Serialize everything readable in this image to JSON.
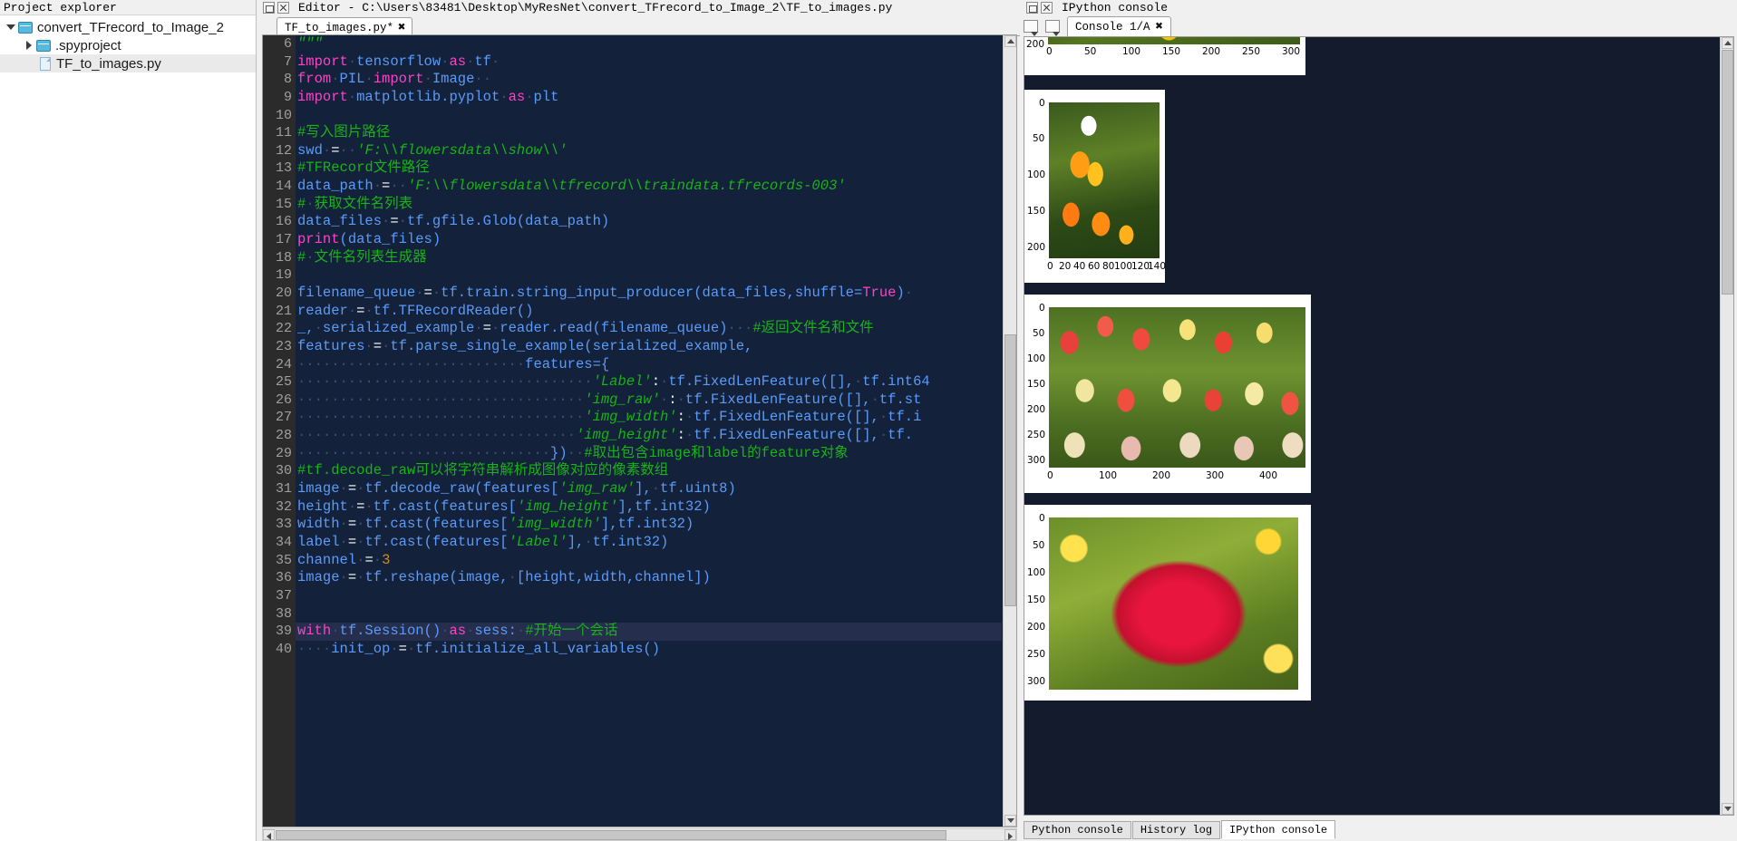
{
  "project_explorer": {
    "title": "Project explorer",
    "tree": [
      {
        "label": "convert_TFrecord_to_Image_2",
        "type": "folder",
        "indent": 1,
        "expanded": true,
        "selected": false
      },
      {
        "label": ".spyproject",
        "type": "folder",
        "indent": 2,
        "expanded": false,
        "selected": false
      },
      {
        "label": "TF_to_images.py",
        "type": "file",
        "indent": 3,
        "expanded": null,
        "selected": true
      }
    ]
  },
  "editor": {
    "title": "Editor - C:\\Users\\83481\\Desktop\\MyResNet\\convert_TFrecord_to_Image_2\\TF_to_images.py",
    "tab": {
      "label": "TF_to_images.py*",
      "close": "✖"
    },
    "first_line_number": 6,
    "highlighted_line": 39,
    "lines": [
      {
        "n": 6,
        "tokens": [
          {
            "t": "\"\"\"",
            "c": "str"
          }
        ]
      },
      {
        "n": 7,
        "tokens": [
          {
            "t": "import",
            "c": "kw"
          },
          {
            "t": "·",
            "c": "dot"
          },
          {
            "t": "tensorflow",
            "c": "id"
          },
          {
            "t": "·",
            "c": "dot"
          },
          {
            "t": "as",
            "c": "kw"
          },
          {
            "t": "·",
            "c": "dot"
          },
          {
            "t": "tf",
            "c": "id"
          },
          {
            "t": "·",
            "c": "dot"
          }
        ]
      },
      {
        "n": 8,
        "tokens": [
          {
            "t": "from",
            "c": "kw"
          },
          {
            "t": "·",
            "c": "dot"
          },
          {
            "t": "PIL",
            "c": "id"
          },
          {
            "t": "·",
            "c": "dot"
          },
          {
            "t": "import",
            "c": "kw"
          },
          {
            "t": "·",
            "c": "dot"
          },
          {
            "t": "Image",
            "c": "id"
          },
          {
            "t": "··",
            "c": "dot"
          }
        ]
      },
      {
        "n": 9,
        "tokens": [
          {
            "t": "import",
            "c": "kw"
          },
          {
            "t": "·",
            "c": "dot"
          },
          {
            "t": "matplotlib.pyplot",
            "c": "id"
          },
          {
            "t": "·",
            "c": "dot"
          },
          {
            "t": "as",
            "c": "kw"
          },
          {
            "t": "·",
            "c": "dot"
          },
          {
            "t": "plt",
            "c": "id"
          }
        ]
      },
      {
        "n": 10,
        "tokens": []
      },
      {
        "n": 11,
        "tokens": [
          {
            "t": "#写入图片路径",
            "c": "com"
          }
        ]
      },
      {
        "n": 12,
        "tokens": [
          {
            "t": "swd",
            "c": "id"
          },
          {
            "t": "·",
            "c": "dot"
          },
          {
            "t": "=",
            "c": "pl"
          },
          {
            "t": "··",
            "c": "dot"
          },
          {
            "t": "'F:\\\\flowersdata\\\\show\\\\'",
            "c": "str"
          }
        ]
      },
      {
        "n": 13,
        "tokens": [
          {
            "t": "#TFRecord文件路径",
            "c": "com"
          }
        ]
      },
      {
        "n": 14,
        "tokens": [
          {
            "t": "data_path",
            "c": "id"
          },
          {
            "t": "·",
            "c": "dot"
          },
          {
            "t": "=",
            "c": "pl"
          },
          {
            "t": "··",
            "c": "dot"
          },
          {
            "t": "'F:\\\\flowersdata\\\\tfrecord\\\\traindata.tfrecords-003'",
            "c": "str"
          }
        ]
      },
      {
        "n": 15,
        "tokens": [
          {
            "t": "#",
            "c": "com"
          },
          {
            "t": "·",
            "c": "dot"
          },
          {
            "t": "获取文件名列表",
            "c": "com"
          }
        ]
      },
      {
        "n": 16,
        "tokens": [
          {
            "t": "data_files",
            "c": "id"
          },
          {
            "t": "·",
            "c": "dot"
          },
          {
            "t": "=",
            "c": "pl"
          },
          {
            "t": "·",
            "c": "dot"
          },
          {
            "t": "tf.gfile.Glob(data_path)",
            "c": "id"
          }
        ]
      },
      {
        "n": 17,
        "tokens": [
          {
            "t": "print",
            "c": "kw"
          },
          {
            "t": "(data_files)",
            "c": "id"
          }
        ]
      },
      {
        "n": 18,
        "tokens": [
          {
            "t": "#",
            "c": "com"
          },
          {
            "t": "·",
            "c": "dot"
          },
          {
            "t": "文件名列表生成器",
            "c": "com"
          }
        ]
      },
      {
        "n": 19,
        "tokens": []
      },
      {
        "n": 20,
        "tokens": [
          {
            "t": "filename_queue",
            "c": "id"
          },
          {
            "t": "·",
            "c": "dot"
          },
          {
            "t": "=",
            "c": "pl"
          },
          {
            "t": "·",
            "c": "dot"
          },
          {
            "t": "tf.train.string_input_producer(data_files,shuffle=",
            "c": "id"
          },
          {
            "t": "True",
            "c": "kw"
          },
          {
            "t": ")",
            "c": "id"
          },
          {
            "t": "·",
            "c": "dot"
          }
        ]
      },
      {
        "n": 21,
        "tokens": [
          {
            "t": "reader",
            "c": "id"
          },
          {
            "t": "·",
            "c": "dot"
          },
          {
            "t": "=",
            "c": "pl"
          },
          {
            "t": "·",
            "c": "dot"
          },
          {
            "t": "tf.TFRecordReader()",
            "c": "id"
          }
        ]
      },
      {
        "n": 22,
        "tokens": [
          {
            "t": "_,",
            "c": "id"
          },
          {
            "t": "·",
            "c": "dot"
          },
          {
            "t": "serialized_example",
            "c": "id"
          },
          {
            "t": "·",
            "c": "dot"
          },
          {
            "t": "=",
            "c": "pl"
          },
          {
            "t": "·",
            "c": "dot"
          },
          {
            "t": "reader.read(filename_queue)",
            "c": "id"
          },
          {
            "t": "···",
            "c": "dot"
          },
          {
            "t": "#返回文件名和文件",
            "c": "com"
          }
        ]
      },
      {
        "n": 23,
        "tokens": [
          {
            "t": "features",
            "c": "id"
          },
          {
            "t": "·",
            "c": "dot"
          },
          {
            "t": "=",
            "c": "pl"
          },
          {
            "t": "·",
            "c": "dot"
          },
          {
            "t": "tf.parse_single_example(serialized_example,",
            "c": "id"
          }
        ]
      },
      {
        "n": 24,
        "tokens": [
          {
            "t": "···························",
            "c": "dot"
          },
          {
            "t": "features={",
            "c": "id"
          }
        ]
      },
      {
        "n": 25,
        "tokens": [
          {
            "t": "···································",
            "c": "dot"
          },
          {
            "t": "'Label'",
            "c": "str"
          },
          {
            "t": ":",
            "c": "pl"
          },
          {
            "t": "·",
            "c": "dot"
          },
          {
            "t": "tf.FixedLenFeature([],",
            "c": "id"
          },
          {
            "t": "·",
            "c": "dot"
          },
          {
            "t": "tf.int64",
            "c": "id"
          }
        ]
      },
      {
        "n": 26,
        "tokens": [
          {
            "t": "··································",
            "c": "dot"
          },
          {
            "t": "'img_raw'",
            "c": "str"
          },
          {
            "t": "·",
            "c": "dot"
          },
          {
            "t": ":",
            "c": "pl"
          },
          {
            "t": "·",
            "c": "dot"
          },
          {
            "t": "tf.FixedLenFeature([],",
            "c": "id"
          },
          {
            "t": "·",
            "c": "dot"
          },
          {
            "t": "tf.st",
            "c": "id"
          }
        ]
      },
      {
        "n": 27,
        "tokens": [
          {
            "t": "··································",
            "c": "dot"
          },
          {
            "t": "'img_width'",
            "c": "str"
          },
          {
            "t": ":",
            "c": "pl"
          },
          {
            "t": "·",
            "c": "dot"
          },
          {
            "t": "tf.FixedLenFeature([],",
            "c": "id"
          },
          {
            "t": "·",
            "c": "dot"
          },
          {
            "t": "tf.i",
            "c": "id"
          }
        ]
      },
      {
        "n": 28,
        "tokens": [
          {
            "t": "·································",
            "c": "dot"
          },
          {
            "t": "'img_height'",
            "c": "str"
          },
          {
            "t": ":",
            "c": "pl"
          },
          {
            "t": "·",
            "c": "dot"
          },
          {
            "t": "tf.FixedLenFeature([],",
            "c": "id"
          },
          {
            "t": "·",
            "c": "dot"
          },
          {
            "t": "tf.",
            "c": "id"
          }
        ]
      },
      {
        "n": 29,
        "tokens": [
          {
            "t": "······························",
            "c": "dot"
          },
          {
            "t": "})",
            "c": "id"
          },
          {
            "t": "··",
            "c": "dot"
          },
          {
            "t": "#取出包含image和label的feature对象",
            "c": "com"
          }
        ]
      },
      {
        "n": 30,
        "tokens": [
          {
            "t": "#tf.decode_raw可以将字符串解析成图像对应的像素数组",
            "c": "com"
          }
        ]
      },
      {
        "n": 31,
        "tokens": [
          {
            "t": "image",
            "c": "id"
          },
          {
            "t": "·",
            "c": "dot"
          },
          {
            "t": "=",
            "c": "pl"
          },
          {
            "t": "·",
            "c": "dot"
          },
          {
            "t": "tf.decode_raw(features[",
            "c": "id"
          },
          {
            "t": "'img_raw'",
            "c": "str"
          },
          {
            "t": "],",
            "c": "id"
          },
          {
            "t": "·",
            "c": "dot"
          },
          {
            "t": "tf.uint8)",
            "c": "id"
          }
        ]
      },
      {
        "n": 32,
        "tokens": [
          {
            "t": "height",
            "c": "id"
          },
          {
            "t": "·",
            "c": "dot"
          },
          {
            "t": "=",
            "c": "pl"
          },
          {
            "t": "·",
            "c": "dot"
          },
          {
            "t": "tf.cast(features[",
            "c": "id"
          },
          {
            "t": "'img_height'",
            "c": "str"
          },
          {
            "t": "],tf.int32)",
            "c": "id"
          }
        ]
      },
      {
        "n": 33,
        "tokens": [
          {
            "t": "width",
            "c": "id"
          },
          {
            "t": "·",
            "c": "dot"
          },
          {
            "t": "=",
            "c": "pl"
          },
          {
            "t": "·",
            "c": "dot"
          },
          {
            "t": "tf.cast(features[",
            "c": "id"
          },
          {
            "t": "'img_width'",
            "c": "str"
          },
          {
            "t": "],tf.int32)",
            "c": "id"
          }
        ]
      },
      {
        "n": 34,
        "tokens": [
          {
            "t": "label",
            "c": "id"
          },
          {
            "t": "·",
            "c": "dot"
          },
          {
            "t": "=",
            "c": "pl"
          },
          {
            "t": "·",
            "c": "dot"
          },
          {
            "t": "tf.cast(features[",
            "c": "id"
          },
          {
            "t": "'Label'",
            "c": "str"
          },
          {
            "t": "],",
            "c": "id"
          },
          {
            "t": "·",
            "c": "dot"
          },
          {
            "t": "tf.int32)",
            "c": "id"
          }
        ]
      },
      {
        "n": 35,
        "tokens": [
          {
            "t": "channel",
            "c": "id"
          },
          {
            "t": "·",
            "c": "dot"
          },
          {
            "t": "=",
            "c": "pl"
          },
          {
            "t": "·",
            "c": "dot"
          },
          {
            "t": "3",
            "c": "num"
          }
        ]
      },
      {
        "n": 36,
        "tokens": [
          {
            "t": "image",
            "c": "id"
          },
          {
            "t": "·",
            "c": "dot"
          },
          {
            "t": "=",
            "c": "pl"
          },
          {
            "t": "·",
            "c": "dot"
          },
          {
            "t": "tf.reshape(image,",
            "c": "id"
          },
          {
            "t": "·",
            "c": "dot"
          },
          {
            "t": "[height,width,channel])",
            "c": "id"
          }
        ]
      },
      {
        "n": 37,
        "tokens": []
      },
      {
        "n": 38,
        "tokens": []
      },
      {
        "n": 39,
        "tokens": [
          {
            "t": "with",
            "c": "kw"
          },
          {
            "t": "·",
            "c": "dot"
          },
          {
            "t": "tf.Session()",
            "c": "id"
          },
          {
            "t": "·",
            "c": "dot"
          },
          {
            "t": "as",
            "c": "kw"
          },
          {
            "t": "·",
            "c": "dot"
          },
          {
            "t": "sess:",
            "c": "id"
          },
          {
            "t": "·",
            "c": "dot"
          },
          {
            "t": "#开始一个会话",
            "c": "com"
          }
        ]
      },
      {
        "n": 40,
        "tokens": [
          {
            "t": "····",
            "c": "dot"
          },
          {
            "t": "init_op",
            "c": "id"
          },
          {
            "t": "·",
            "c": "dot"
          },
          {
            "t": "=",
            "c": "pl"
          },
          {
            "t": "·",
            "c": "dot"
          },
          {
            "t": "tf.initialize_all_variables()",
            "c": "id"
          }
        ]
      }
    ]
  },
  "console": {
    "title": "IPython console",
    "tab": {
      "label": "Console 1/A",
      "close": "✖"
    },
    "bottom_tabs": [
      {
        "label": "Python console",
        "active": false
      },
      {
        "label": "History log",
        "active": false
      },
      {
        "label": "IPython console",
        "active": true
      }
    ],
    "plots": [
      {
        "name": "plot-1-partial",
        "yticks": [
          "200"
        ],
        "xticks": [
          "0",
          "50",
          "100",
          "150",
          "200",
          "250",
          "300"
        ],
        "kind": "image"
      },
      {
        "name": "plot-2-tulips-yellow",
        "yticks": [
          "0",
          "50",
          "100",
          "150",
          "200"
        ],
        "xticks": [
          "0",
          "20",
          "40",
          "60",
          "80",
          "100",
          "120",
          "140"
        ],
        "kind": "image"
      },
      {
        "name": "plot-3-tulip-field",
        "yticks": [
          "0",
          "50",
          "100",
          "150",
          "200",
          "250",
          "300"
        ],
        "xticks": [
          "0",
          "100",
          "200",
          "300",
          "400"
        ],
        "kind": "image"
      },
      {
        "name": "plot-4-red-rose",
        "yticks": [
          "0",
          "50",
          "100",
          "150",
          "200",
          "250",
          "300"
        ],
        "xticks": [],
        "kind": "image"
      }
    ]
  },
  "colors": {
    "editor_bg": "#14213a",
    "gutter_bg": "#2b2b2b",
    "console_bg": "#141b2d",
    "string": "#19b219",
    "keyword": "#ff41c8",
    "identifier": "#5b9bf8",
    "highlight_line": "#252e4d",
    "chrome": "#f0f0f0"
  }
}
